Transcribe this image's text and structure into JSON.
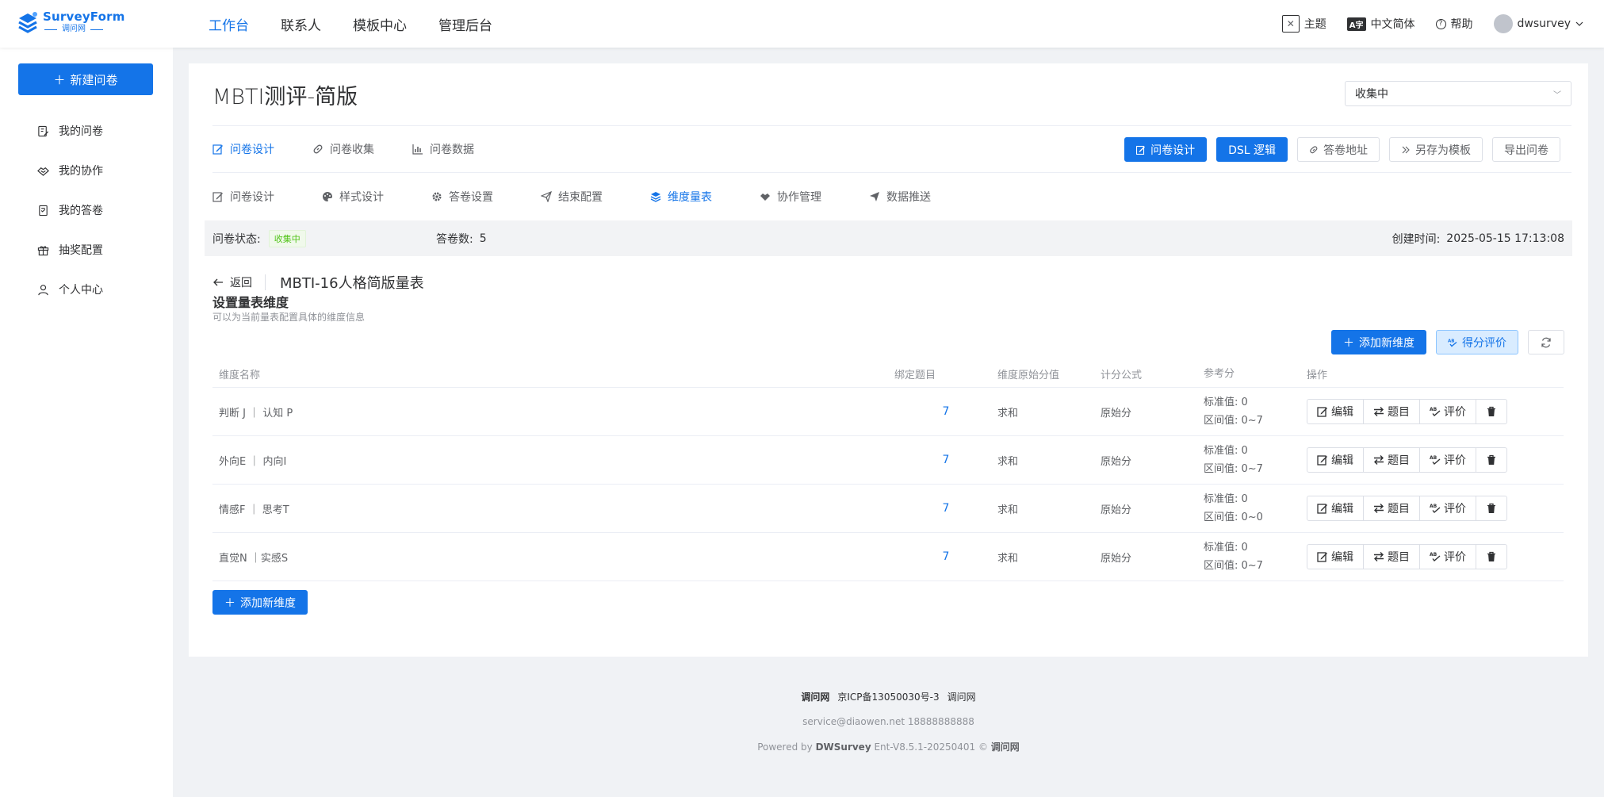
{
  "logo": {
    "main": "SurveyForm",
    "sub": "调问网"
  },
  "topnav": [
    "工作台",
    "联系人",
    "模板中心",
    "管理后台"
  ],
  "topright": {
    "theme": "主题",
    "lang_icon": "A字",
    "lang": "中文简体",
    "help": "帮助",
    "user": "dwsurvey"
  },
  "sidebar": {
    "new_button": "新建问卷",
    "items": [
      {
        "label": "我的问卷",
        "icon": "edit-doc-icon"
      },
      {
        "label": "我的协作",
        "icon": "handshake-icon"
      },
      {
        "label": "我的答卷",
        "icon": "answer-doc-icon"
      },
      {
        "label": "抽奖配置",
        "icon": "gift-icon"
      },
      {
        "label": "个人中心",
        "icon": "user-icon"
      }
    ]
  },
  "survey": {
    "title": "MBTI测评-简版",
    "status_select": "收集中"
  },
  "tabs1": [
    "问卷设计",
    "问卷收集",
    "问卷数据"
  ],
  "actions": {
    "design": "问卷设计",
    "dsl": "DSL 逻辑",
    "address": "答卷地址",
    "save_template": "另存为模板",
    "export": "导出问卷"
  },
  "tabs2": [
    "问卷设计",
    "样式设计",
    "答卷设置",
    "结束配置",
    "维度量表",
    "协作管理",
    "数据推送"
  ],
  "info": {
    "status_label": "问卷状态:",
    "status_badge": "收集中",
    "count_label": "答卷数:",
    "count": "5",
    "time_label": "创建时间:",
    "time": "2025-05-15 17:13:08"
  },
  "scale": {
    "back": "返回",
    "name": "MBTI-16人格简版量表",
    "section_title": "设置量表维度",
    "section_sub": "可以为当前量表配置具体的维度信息",
    "add_button": "添加新维度",
    "score_button": "得分评价"
  },
  "table": {
    "headers": [
      "维度名称",
      "绑定题目",
      "维度原始分值",
      "计分公式",
      "参考分",
      "操作"
    ],
    "rows": [
      {
        "name": "判断 J ｜ 认知 P",
        "count": "7",
        "raw": "求和",
        "formula": "原始分",
        "std": "标准值:  0",
        "range": "区间值:  0~7"
      },
      {
        "name": "外向E ｜ 内向I",
        "count": "7",
        "raw": "求和",
        "formula": "原始分",
        "std": "标准值:  0",
        "range": "区间值:  0~7"
      },
      {
        "name": "情感F ｜ 思考T",
        "count": "7",
        "raw": "求和",
        "formula": "原始分",
        "std": "标准值:  0",
        "range": "区间值:  0~0"
      },
      {
        "name": "直觉N ｜实感S",
        "count": "7",
        "raw": "求和",
        "formula": "原始分",
        "std": "标准值:  0",
        "range": "区间值:  0~7"
      }
    ],
    "ops": {
      "edit": "编辑",
      "questions": "题目",
      "evaluate": "评价"
    }
  },
  "footer": {
    "brand": "调问网",
    "icp": "京ICP备13050030号-3",
    "brand2": "调问网",
    "contact": "service@diaowen.net 18888888888",
    "powered_prefix": "Powered by ",
    "powered_brand": "DWSurvey",
    "powered_suffix": " Ent-V8.5.1-20250401 © ",
    "powered_owner": "调问网"
  }
}
